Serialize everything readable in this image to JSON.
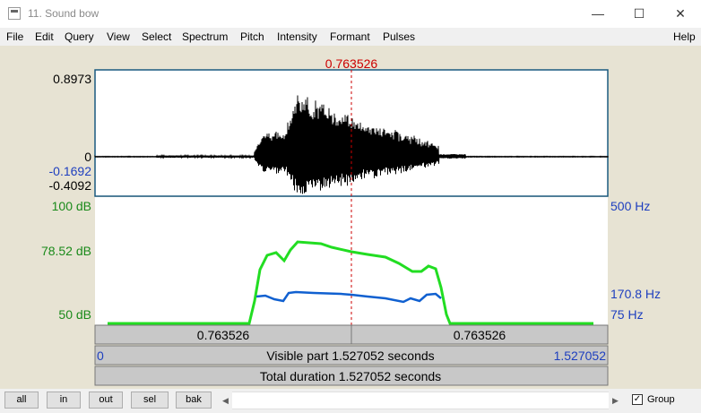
{
  "window": {
    "title": "11. Sound bow",
    "icon": "praat-window-icon",
    "controls": [
      "—",
      "☐",
      "✕"
    ]
  },
  "menu": {
    "items": [
      "File",
      "Edit",
      "Query",
      "View",
      "Select",
      "Spectrum",
      "Pitch",
      "Intensity",
      "Formant",
      "Pulses"
    ],
    "help": "Help"
  },
  "editor": {
    "cursor_time": "0.763526",
    "waveform": {
      "max_label": "0.8973",
      "zero_label": "0",
      "cursor_value_label": "-0.1692",
      "min_label": "-0.4092"
    },
    "intensity": {
      "top_label": "100 dB",
      "cursor_label": "78.52 dB",
      "bottom_label": "50 dB",
      "color": "#22dd22"
    },
    "pitch": {
      "top_label": "500 Hz",
      "cursor_label": "170.8 Hz",
      "bottom_label": "75 Hz",
      "color": "#1060d0"
    },
    "cursor_color": "#cc0000",
    "bars": {
      "left_segment": "0.763526",
      "right_segment": "0.763526",
      "visible_start": "0",
      "visible_text": "Visible part 1.527052 seconds",
      "visible_end": "1.527052",
      "total_text": "Total duration 1.527052 seconds"
    }
  },
  "bottom": {
    "buttons": [
      "all",
      "in",
      "out",
      "sel",
      "bak"
    ],
    "group_label": "Group",
    "group_checked": "✓"
  }
}
